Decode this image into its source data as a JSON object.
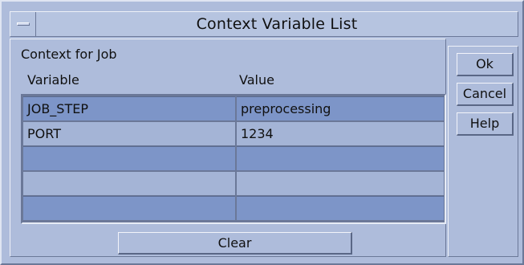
{
  "window": {
    "title": "Context Variable List"
  },
  "form": {
    "section_label": "Context for Job",
    "columns": [
      "Variable",
      "Value"
    ],
    "rows": [
      {
        "variable": "JOB_STEP",
        "value": "preprocessing"
      },
      {
        "variable": "PORT",
        "value": "1234"
      },
      {
        "variable": "",
        "value": ""
      },
      {
        "variable": "",
        "value": ""
      },
      {
        "variable": "",
        "value": ""
      }
    ],
    "clear_label": "Clear"
  },
  "buttons": {
    "ok": "Ok",
    "cancel": "Cancel",
    "help": "Help"
  },
  "colors": {
    "window_bg": "#aebcdb",
    "row_dark": "#7d95c8",
    "row_light": "#a4b4d6"
  }
}
